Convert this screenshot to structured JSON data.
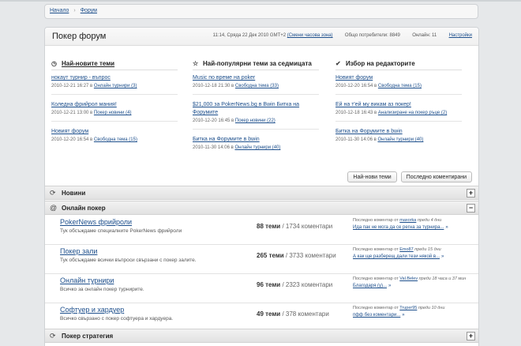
{
  "breadcrumb": {
    "home": "Начало",
    "separator": "›",
    "current": "Форум"
  },
  "header": {
    "title": "Покер форум",
    "datetime": "11:14, Сряда 22 Дек 2010 GMT+2",
    "change_tz": "(Смени часова зона)",
    "users_label": "Общо потребители: 8849",
    "online_label": "Онлайн: 11",
    "settings": "Настройки"
  },
  "columns": [
    {
      "icon": "clock-icon",
      "icon_glyph": "◷",
      "title": "Най-новите теми",
      "topics": [
        {
          "title": "нокаут турнир - въпрос",
          "date": "2010-12-21 16:27 в",
          "forum": "Онлайн турнири (3)"
        },
        {
          "title": "Коледна фрийрол мания!",
          "date": "2010-12-21 13:00 в",
          "forum": "Покер новини (4)"
        },
        {
          "title": "Новият форум",
          "date": "2010-12-20 16:54 в",
          "forum": "Свободна тема (15)"
        }
      ]
    },
    {
      "icon": "star-icon",
      "icon_glyph": "☆",
      "title": "Най-популярни теми за седмицата",
      "topics": [
        {
          "title": "Music по време на poker",
          "date": "2010-12-18 21:30 в",
          "forum": "Свободна тема (33)"
        },
        {
          "title": "$21,000 за PokerNews.bg в Bwin Битка на Форумите",
          "date": "2010-12-20 16:45 в",
          "forum": "Покер новини (22)"
        },
        {
          "title": "Битка на Форумите в bwin",
          "date": "2010-11-30 14:06 в",
          "forum": "Онлайн турнири (40)"
        }
      ]
    },
    {
      "icon": "check-icon",
      "icon_glyph": "✔",
      "title": "Избор на редакторите",
      "topics": [
        {
          "title": "Новият форум",
          "date": "2010-12-20 16:54 в",
          "forum": "Свободна тема (15)"
        },
        {
          "title": "Ей на т'ей му викам аз покер!",
          "date": "2010-12-18 16:43 в",
          "forum": "Анализиране на покер ръце (2)"
        },
        {
          "title": "Битка на Форумите в bwin",
          "date": "2010-11-30 14:06 в",
          "forum": "Онлайн турнири (40)"
        }
      ]
    }
  ],
  "buttons": {
    "newest": "Най-нови теми",
    "last_commented": "Последно коментирани"
  },
  "sections": {
    "news": {
      "title": "Новини",
      "toggle": "+"
    },
    "online": {
      "title": "Онлайн покер",
      "toggle": "−"
    },
    "strategy": {
      "title": "Покер стратегия",
      "toggle": "+"
    }
  },
  "forums": [
    {
      "name": "PokerNews фрийроли",
      "desc": "Тук обсъждаме специалните PokerNews фрийроли",
      "topics": "88 теми",
      "comments": " / 1734 коментари",
      "last_prefix": "Последно коментар от",
      "last_user": "maxorka",
      "last_when": "преди 4 дни",
      "last_topic": "Ида пак не мога да се регна за турнира..."
    },
    {
      "name": "Покер зали",
      "desc": "Тук обсъждаме всички въпроси свързани с покер залите.",
      "topics": "265 теми",
      "comments": " / 3733 коментари",
      "last_prefix": "Последно коментар от",
      "last_user": "Emo87",
      "last_when": "преди 15 дни",
      "last_topic": "А как ще разберещ дали тези някой в..."
    },
    {
      "name": "Онлайн турнири",
      "desc": "Всичко за онлайн покер турнирите.",
      "topics": "96 теми",
      "comments": " / 2323 коментари",
      "last_prefix": "Последно коментар от",
      "last_user": "Val.Belev",
      "last_when": "преди 18 часа и 37 мин",
      "last_topic": "Благодаря (у)..."
    },
    {
      "name": "Софтуер и хардуер",
      "desc": "Всичко свързано с покер софтуера и хардуера.",
      "topics": "49 теми",
      "comments": " / 378 коментари",
      "last_prefix": "Последно коментар от",
      "last_user": "Truper95",
      "last_when": "преди 10 дни",
      "last_topic": "пфф без коментари..."
    }
  ],
  "colors": {
    "link": "#1d4f8c",
    "background": "#e6e8ea"
  }
}
